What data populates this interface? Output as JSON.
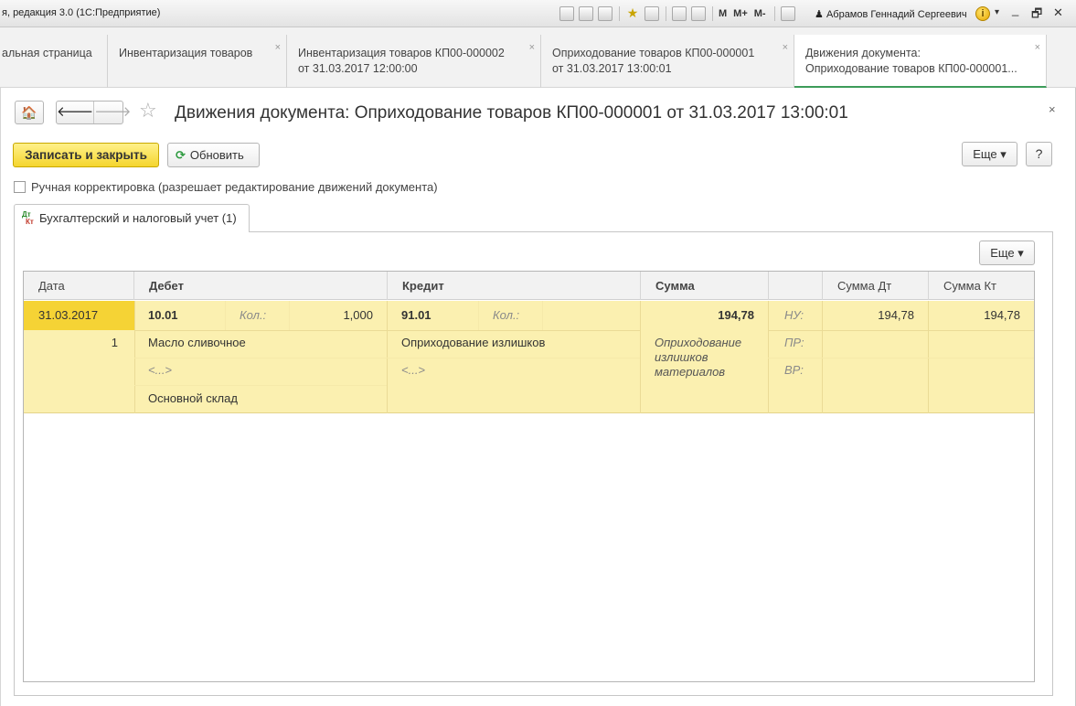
{
  "window": {
    "app_title": "я, редакция 3.0  (1С:Предприятие)",
    "toolbar_m": "M",
    "toolbar_m_plus": "M+",
    "toolbar_m_minus": "M-",
    "user": "Абрамов Геннадий Сергеевич",
    "info_glyph": "i",
    "ctrl_menu": "▾",
    "ctrl_min": "_",
    "ctrl_max": "🗗",
    "ctrl_close": "✕"
  },
  "tabs": [
    {
      "line1": "альная страница",
      "line2": ""
    },
    {
      "line1": "Инвентаризация товаров",
      "line2": ""
    },
    {
      "line1": "Инвентаризация товаров КП00-000002",
      "line2": "от 31.03.2017 12:00:00"
    },
    {
      "line1": "Оприходование товаров КП00-000001",
      "line2": "от 31.03.2017 13:00:01"
    },
    {
      "line1": "Движения документа:",
      "line2": "Оприходование товаров КП00-000001..."
    }
  ],
  "tab_close_glyph": "×",
  "form": {
    "title": "Движения документа: Оприходование товаров КП00-000001 от 31.03.2017 13:00:01",
    "close_glyph": "×",
    "home_glyph": "🏠",
    "back_glyph": "🡐",
    "fwd_glyph": "🡒",
    "fav_glyph": "☆",
    "save_close_label": "Записать и закрыть",
    "refresh_glyph": "⟳",
    "refresh_label": "Обновить",
    "more_label": "Еще ▾",
    "help_label": "?",
    "manual_correction_label": "Ручная корректировка (разрешает редактирование движений документа)",
    "page_tab_dt": "Дт",
    "page_tab_kt": "Кт",
    "page_tab_label": "Бухгалтерский и налоговый учет (1)",
    "grid_more_label": "Еще ▾"
  },
  "grid": {
    "headers": [
      "Дата",
      "Дебет",
      "Кредит",
      "Сумма",
      "",
      "Сумма Дт",
      "Сумма Кт"
    ],
    "row": {
      "date": "31.03.2017",
      "num": "1",
      "debit_account": "10.01",
      "debit_qty_label": "Кол.:",
      "debit_qty": "1,000",
      "debit_sub1": "Масло сливочное",
      "debit_sub2": "<...>",
      "debit_sub3": "Основной склад",
      "credit_account": "91.01",
      "credit_qty_label": "Кол.:",
      "credit_sub1": "Оприходование излишков",
      "credit_sub2": "<...>",
      "sum": "194,78",
      "content_line1": "Оприходование",
      "content_line2": "излишков",
      "content_line3": "материалов",
      "nu_label": "НУ:",
      "pr_label": "ПР:",
      "vr_label": "ВР:",
      "sum_dt": "194,78",
      "sum_kt": "194,78"
    }
  }
}
